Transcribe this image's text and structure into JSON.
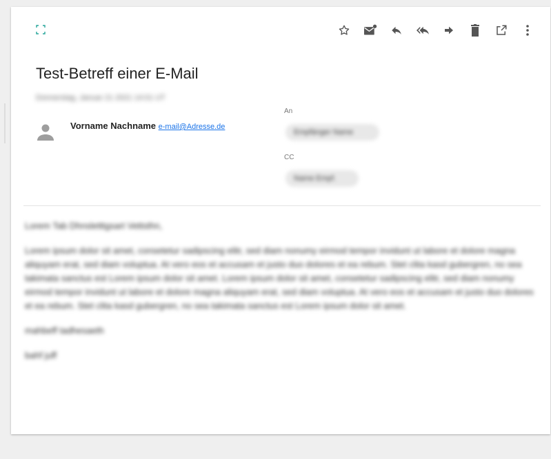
{
  "email": {
    "subject": "Test-Betreff einer E-Mail",
    "date": "Donnerstag, Januar 21 2021 14:01 UT",
    "sender": {
      "name": "Vorname Nachname",
      "email": "e-mail@Adresse.de"
    },
    "to_label": "An",
    "to_recipient": "Empfänger Name",
    "cc_label": "CC",
    "cc_recipient": "Name Empf.",
    "body": {
      "greeting": "Lorem Tab Dhnsletttgsart Vettsthn,",
      "paragraph": "Lorem ipsum dolor sit amet, consetetur sadipscing elitr, sed diam nonumy eirmod tempor invidunt ut labore et dolore magna aliquyam erat, sed diam voluptua. At vero eos et accusam et justo duo dolores et ea rebum. Stet clita kasd gubergren, no sea takimata sanctus est Lorem ipsum dolor sit amet. Lorem ipsum dolor sit amet, consetetur sadipscing elitr, sed diam nonumy eirmod tempor invidunt ut labore et dolore magna aliquyam erat, sed diam voluptua. At vero eos et accusam et justo duo dolores et ea rebum. Stet clita kasd gubergren, no sea takimata sanctus est Lorem ipsum dolor sit amet.",
      "closing": "mahbeff tadhesaeth",
      "signature": "bahf juff"
    }
  },
  "toolbar": {
    "icons": [
      "star-icon",
      "mark-unread-icon",
      "reply-icon",
      "reply-all-icon",
      "forward-icon",
      "delete-icon",
      "open-external-icon",
      "more-vert-icon"
    ]
  },
  "colors": {
    "accent_teal": "#26a69a",
    "link_blue": "#1a73e8",
    "icon_gray": "#555555"
  }
}
